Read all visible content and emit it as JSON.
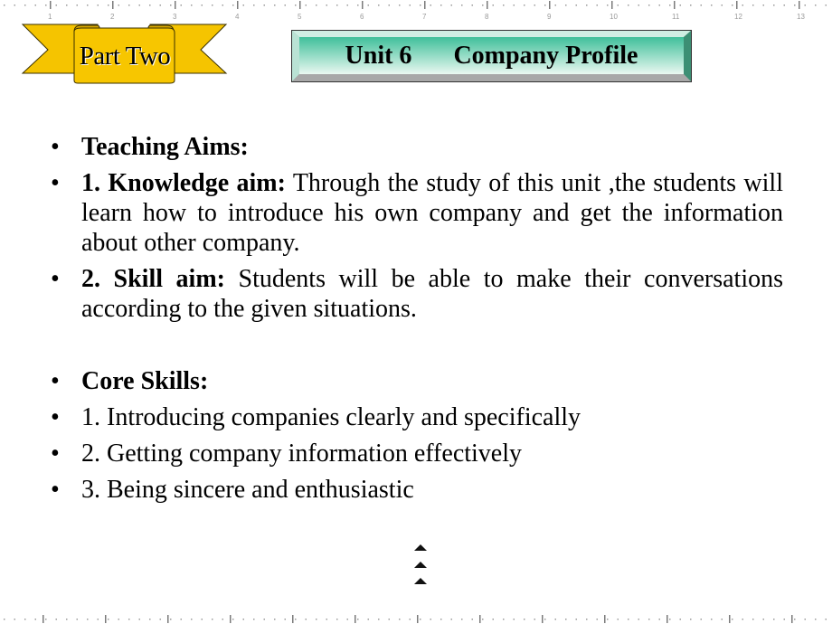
{
  "ruler": {
    "top_labels": [
      "1",
      "2",
      "3",
      "4",
      "5",
      "6",
      "7",
      "8",
      "9",
      "10",
      "11",
      "12",
      "13"
    ]
  },
  "banner": {
    "label": "Part Two",
    "fill_color": "#f5c400"
  },
  "title": {
    "unit": "Unit 6",
    "name": "Company Profile",
    "gradient_top": "#3fbf9a",
    "gradient_bottom": "#e6f7ef"
  },
  "content": {
    "items": [
      {
        "lead": "Teaching Aims:",
        "text": ""
      },
      {
        "lead": "1. Knowledge aim:",
        "text": " Through the study of this unit ,the students will learn how to introduce his own company and get the information about other company."
      },
      {
        "lead": "2. Skill aim:",
        "text": " Students will be able to make their conversations according to the given situations."
      },
      {
        "lead": "Core Skills:",
        "text": ""
      },
      {
        "lead": "",
        "text": "1. Introducing companies clearly and specifically"
      },
      {
        "lead": "",
        "text": "2. Getting company information effectively"
      },
      {
        "lead": "",
        "text": "3. Being sincere and enthusiastic"
      }
    ],
    "bullet": "•"
  },
  "navigation": {
    "arrows": [
      "up-arrow",
      "up-arrow",
      "up-arrow"
    ]
  }
}
